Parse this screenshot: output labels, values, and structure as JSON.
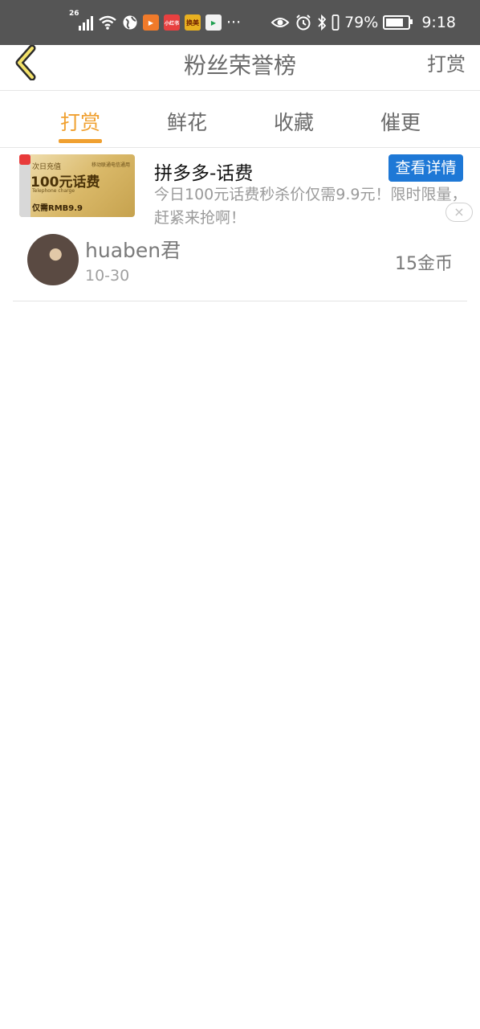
{
  "statusbar": {
    "network_type": "26",
    "battery": "79%",
    "time": "9:18",
    "battery_level": 0.79,
    "more": "···",
    "apps": [
      {
        "icon": "orange-play-icon",
        "color": "#f07a2a",
        "label": "▶"
      },
      {
        "icon": "red-app-icon",
        "color": "#e84040",
        "label": "小红书"
      },
      {
        "icon": "game-app-icon",
        "color": "#e8b020",
        "label": "换美"
      },
      {
        "icon": "google-play-icon",
        "color": "#f2f2f2",
        "label": "▶"
      }
    ]
  },
  "header": {
    "title": "粉丝荣誉榜",
    "action": "打赏"
  },
  "tabs": [
    {
      "label": "打赏",
      "active": true
    },
    {
      "label": "鲜花",
      "active": false
    },
    {
      "label": "收藏",
      "active": false
    },
    {
      "label": "催更",
      "active": false
    }
  ],
  "ad": {
    "image_text": {
      "line1": "次日充值",
      "line_top_right": "移动联通电信通用",
      "line2": "100元话费",
      "line3": "Telephone charge",
      "line4": "仅需RMB9.9"
    },
    "title": "拼多多-话费",
    "description": "今日100元话费秒杀价仅需9.9元！限时限量，赶紧来抢啊！",
    "cta": "查看详情",
    "close": "×"
  },
  "list": [
    {
      "name": "huaben君",
      "date": "10-30",
      "amount": "15金币"
    }
  ],
  "colors": {
    "accent": "#f0a030",
    "cta": "#1e78d6",
    "statusbar": "#555555"
  }
}
